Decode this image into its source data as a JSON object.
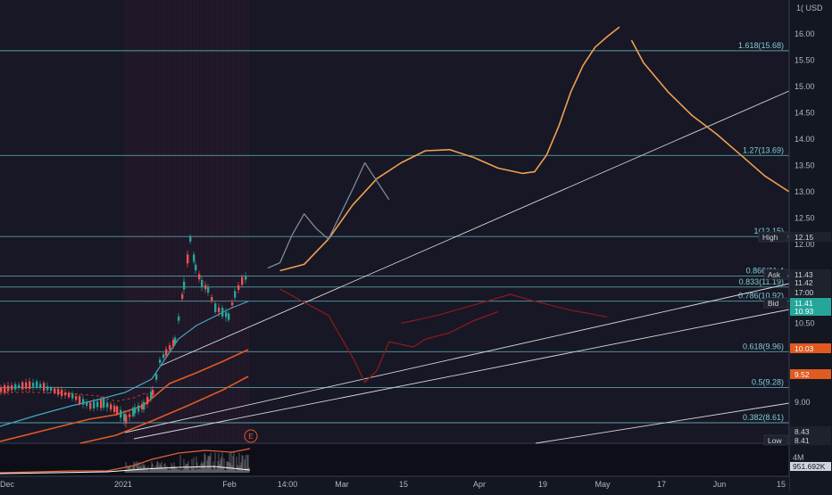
{
  "chart_data": {
    "type": "line",
    "symbol_currency_label": "USD",
    "y_axis_ticks": [
      16.0,
      15.5,
      15.0,
      14.5,
      14.0,
      13.5,
      13.0,
      12.5,
      12.0,
      10.5,
      9.0
    ],
    "y_axis_tick_labels": [
      "16.00",
      "15.50",
      "15.00",
      "14.50",
      "14.00",
      "13.50",
      "13.00",
      "12.50",
      "12.00",
      "10.50",
      "9.00"
    ],
    "x_axis_labels": [
      "Dec",
      "2021",
      "Feb",
      "14:00",
      "Mar",
      "15",
      "Apr",
      "19",
      "May",
      "17",
      "Jun",
      "15"
    ],
    "ylim": [
      8.4,
      16.5
    ],
    "fib_levels": [
      {
        "label": "1.618(15.68)",
        "value": 15.68
      },
      {
        "label": "1.27(13.69)",
        "value": 13.69
      },
      {
        "label": "1(12.15)",
        "value": 12.15
      },
      {
        "label": "0.866(11.4",
        "value": 11.4
      },
      {
        "label": "0.833(11.19)",
        "value": 11.19
      },
      {
        "label": "0.786(10.92)",
        "value": 10.92
      },
      {
        "label": "0.618(9.96)",
        "value": 9.96
      },
      {
        "label": "0.5(9.28)",
        "value": 9.28
      },
      {
        "label": "0.382(8.61)",
        "value": 8.61
      }
    ],
    "price_badges": [
      {
        "label": "High",
        "value": "12.15"
      },
      {
        "label": "Ask",
        "value": "11.43"
      },
      {
        "label": "",
        "value": "11.42"
      },
      {
        "label": "",
        "value": "17:00"
      },
      {
        "label": "Bid",
        "value": "11.41"
      },
      {
        "label": "",
        "value": "10.93"
      },
      {
        "label": "",
        "value": "10.03"
      },
      {
        "label": "",
        "value": "9.52"
      },
      {
        "label": "",
        "value": "8.43"
      },
      {
        "label": "Low",
        "value": "8.41"
      }
    ],
    "volume_axis_labels": [
      "4M",
      "951.692K"
    ],
    "event_marker": "E",
    "projection_orange": [
      [
        1,
        11.5
      ],
      [
        3,
        11.62
      ],
      [
        5,
        12.1
      ],
      [
        7,
        12.75
      ],
      [
        9,
        13.25
      ],
      [
        11,
        13.55
      ],
      [
        13,
        13.78
      ],
      [
        15,
        13.8
      ],
      [
        17,
        13.65
      ],
      [
        19,
        13.45
      ],
      [
        21,
        13.35
      ],
      [
        22,
        13.38
      ],
      [
        23,
        13.7
      ],
      [
        24,
        14.25
      ],
      [
        25,
        14.9
      ],
      [
        26,
        15.4
      ],
      [
        27,
        15.75
      ],
      [
        28,
        15.95
      ],
      [
        29,
        16.13
      ]
    ],
    "projection_orange_2": [
      [
        30,
        15.88
      ],
      [
        31,
        15.45
      ],
      [
        33,
        14.9
      ],
      [
        35,
        14.45
      ],
      [
        37,
        14.1
      ],
      [
        39,
        13.7
      ],
      [
        41,
        13.3
      ],
      [
        43,
        13.0
      ]
    ],
    "projection_gray": [
      [
        0,
        11.55
      ],
      [
        1,
        11.65
      ],
      [
        2,
        12.18
      ],
      [
        3,
        12.58
      ],
      [
        4,
        12.3
      ],
      [
        5,
        12.1
      ],
      [
        7,
        13.05
      ],
      [
        8,
        13.55
      ],
      [
        9,
        13.2
      ],
      [
        10,
        12.85
      ]
    ],
    "projection_darkred": [
      [
        1,
        11.15
      ],
      [
        3,
        10.9
      ],
      [
        5,
        10.65
      ],
      [
        7,
        9.85
      ],
      [
        8,
        9.38
      ],
      [
        9,
        9.6
      ],
      [
        10,
        10.15
      ],
      [
        11,
        10.1
      ],
      [
        12,
        10.05
      ],
      [
        13,
        10.2
      ],
      [
        15,
        10.32
      ],
      [
        17,
        10.55
      ],
      [
        19,
        10.72
      ]
    ],
    "projection_darkred_2": [
      [
        11,
        10.5
      ],
      [
        14,
        10.65
      ],
      [
        17,
        10.85
      ],
      [
        20,
        11.05
      ],
      [
        22,
        10.92
      ],
      [
        25,
        10.75
      ],
      [
        28,
        10.62
      ]
    ]
  }
}
